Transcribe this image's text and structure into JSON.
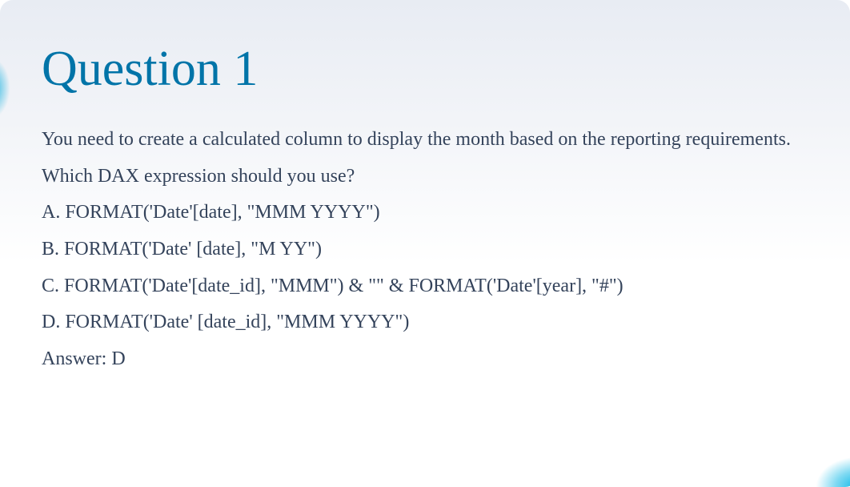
{
  "title": "Question 1",
  "prompt_line1": "You need to create a calculated column to display the month based on the reporting requirements.",
  "prompt_line2": "Which DAX expression should you use?",
  "options": {
    "a": "A. FORMAT('Date'[date], \"MMM YYYY\")",
    "b": "B. FORMAT('Date' [date], \"M YY\")",
    "c": "C. FORMAT('Date'[date_id], \"MMM\") & \"\" & FORMAT('Date'[year], \"#\")",
    "d": "D. FORMAT('Date' [date_id], \"MMM YYYY\")"
  },
  "answer": "Answer: D"
}
